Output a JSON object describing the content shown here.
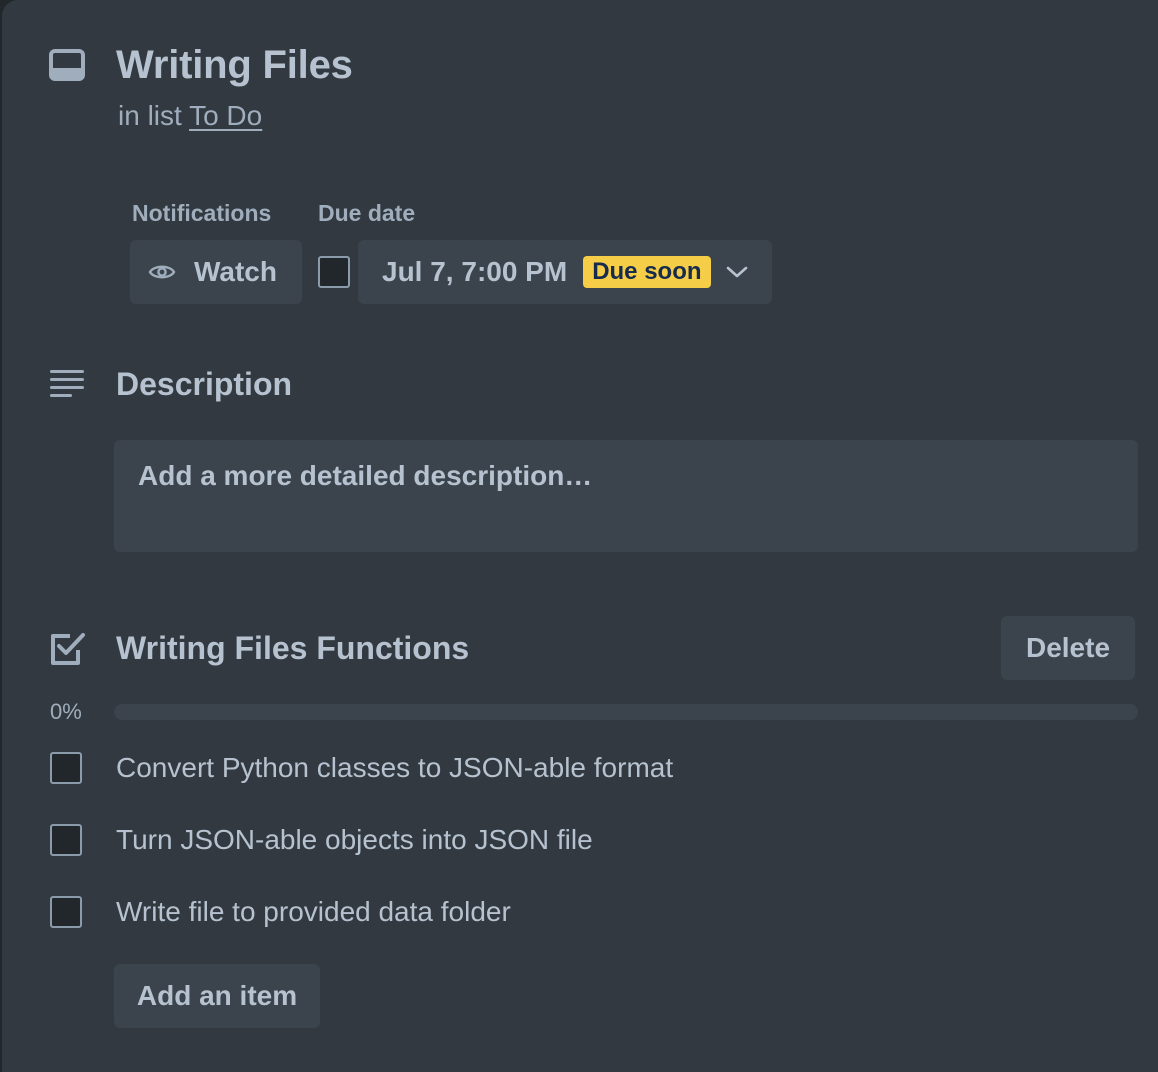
{
  "card": {
    "title": "Writing Files",
    "in_list_prefix": "in list",
    "list_name": "To Do"
  },
  "notifications": {
    "label": "Notifications",
    "watch_label": "Watch"
  },
  "due_date": {
    "label": "Due date",
    "checked": false,
    "value": "Jul 7, 7:00 PM",
    "badge": "Due soon",
    "badge_color": "#f5cd47"
  },
  "description": {
    "title": "Description",
    "placeholder": "Add a more detailed description…"
  },
  "checklist": {
    "title": "Writing Files Functions",
    "delete_label": "Delete",
    "progress_label": "0%",
    "progress_fraction": 0,
    "items": [
      {
        "text": "Convert Python classes to JSON-able format",
        "checked": false
      },
      {
        "text": "Turn JSON-able objects into JSON file",
        "checked": false
      },
      {
        "text": "Write file to provided data folder",
        "checked": false
      }
    ],
    "add_item_label": "Add an item"
  },
  "icons": {
    "card": "card-icon",
    "watch": "eye-icon",
    "due_chevron": "chevron-down-icon",
    "description": "description-lines-icon",
    "checklist": "checklist-icon"
  },
  "colors": {
    "background": "#323940",
    "button": "#3b444c",
    "text": "#b6c2cf",
    "subtle_text": "#9fadbc"
  }
}
